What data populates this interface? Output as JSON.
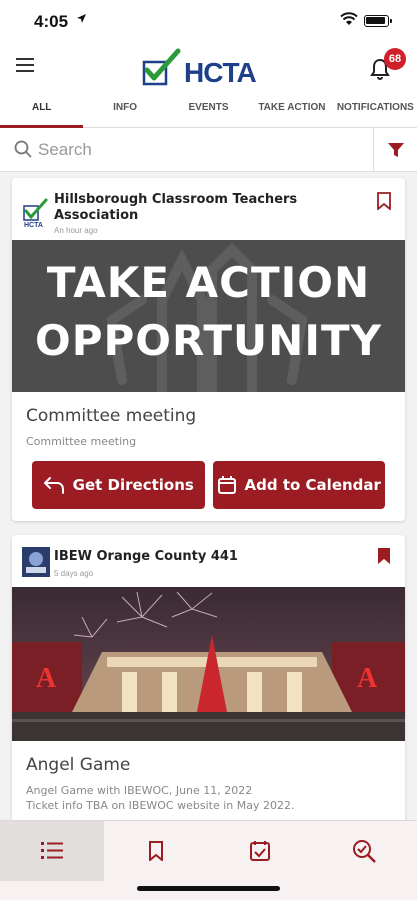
{
  "status_bar": {
    "time": "4:05"
  },
  "header": {
    "logo_text": "HCTA",
    "notification_count": "68"
  },
  "tabs": [
    {
      "label": "ALL"
    },
    {
      "label": "INFO"
    },
    {
      "label": "EVENTS"
    },
    {
      "label": "TAKE ACTION"
    },
    {
      "label": "NOTIFICATIONS"
    }
  ],
  "search": {
    "placeholder": "Search"
  },
  "feed": [
    {
      "org": "Hillsborough Classroom Teachers Association",
      "time": "An hour ago",
      "banner_line1": "TAKE ACTION",
      "banner_line2": "OPPORTUNITY",
      "title": "Committee meeting",
      "description": "Committee meeting",
      "buttons": [
        {
          "label": "Get Directions"
        },
        {
          "label": "Add to Calendar"
        }
      ]
    },
    {
      "org": "IBEW Orange County 441",
      "time": "5 days ago",
      "title": "Angel Game",
      "description_line1": "Angel Game with IBEWOC, June 11, 2022",
      "description_line2": "Ticket info TBA on IBEWOC website in May 2022."
    }
  ],
  "bottom_nav": [
    {
      "icon": "list-icon"
    },
    {
      "icon": "bookmark-icon"
    },
    {
      "icon": "checkbox-icon"
    },
    {
      "icon": "search-check-icon"
    }
  ],
  "colors": {
    "accent": "#9b1c22",
    "brand_blue": "#1e3f8a",
    "badge": "#d0202a"
  }
}
